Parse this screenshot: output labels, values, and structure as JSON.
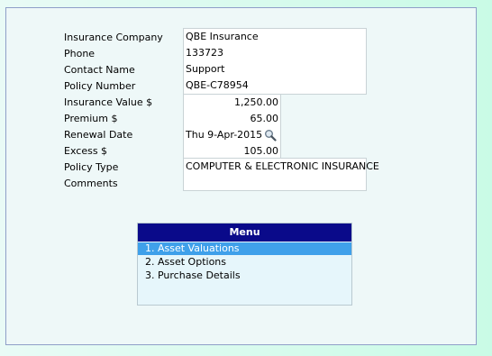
{
  "fields": [
    {
      "label": "Insurance Company"
    },
    {
      "label": "Phone"
    },
    {
      "label": "Contact Name"
    },
    {
      "label": "Policy Number"
    },
    {
      "label": "Insurance Value $"
    },
    {
      "label": "Premium $"
    },
    {
      "label": "Renewal Date"
    },
    {
      "label": "Excess $"
    },
    {
      "label": "Policy Type"
    },
    {
      "label": "Comments"
    }
  ],
  "values": {
    "company": "QBE Insurance",
    "phone": "133723",
    "contact": "Support",
    "policy_number": "QBE-C78954",
    "insurance_value": "1,250.00",
    "premium": "65.00",
    "renewal_date": "Thu 9-Apr-2015",
    "excess": "105.00",
    "policy_type": "COMPUTER & ELECTRONIC INSURANCE"
  },
  "menu": {
    "title": "Menu",
    "items": [
      {
        "label": "1. Asset Valuations",
        "selected": true
      },
      {
        "label": "2. Asset Options",
        "selected": false
      },
      {
        "label": "3. Purchase Details",
        "selected": false
      }
    ]
  },
  "icons": {
    "date_lookup": "search-icon"
  },
  "colors": {
    "menu_header": "#0a0a8a",
    "menu_selection": "#3fa0ea",
    "panel": "#eef8f8"
  }
}
